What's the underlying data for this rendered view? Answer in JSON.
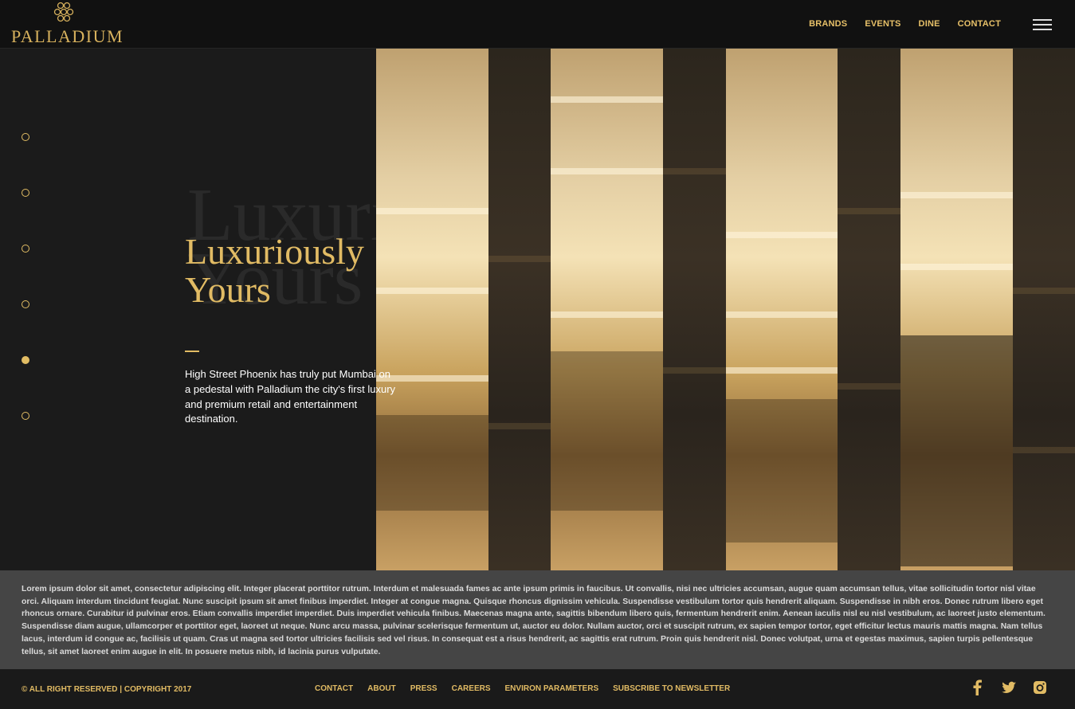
{
  "header": {
    "logo_text": "PALLADIUM",
    "nav": [
      "BRANDS",
      "EVENTS",
      "DINE",
      "CONTACT"
    ]
  },
  "hero": {
    "headline": "Luxuriously\nYours",
    "ghost_text": "Luxuriously\nYours",
    "description": "High Street Phoenix has truly put Mumbai on a pedestal with Palladium the city's first luxury and premium retail and entertainment destination."
  },
  "slider": {
    "count": 6,
    "active_index": 4
  },
  "body_text": "Lorem ipsum dolor sit amet, consectetur adipiscing elit. Integer placerat porttitor rutrum. Interdum et malesuada fames ac ante ipsum primis in faucibus. Ut convallis, nisi nec ultricies accumsan, augue quam accumsan tellus, vitae sollicitudin tortor nisl vitae orci. Aliquam interdum tincidunt feugiat. Nunc suscipit ipsum sit amet finibus imperdiet. Integer at congue magna. Quisque rhoncus dignissim vehicula. Suspendisse vestibulum tortor quis hendrerit aliquam. Suspendisse in nibh eros. Donec rutrum libero eget rhoncus ornare. Curabitur id pulvinar eros. Etiam convallis imperdiet imperdiet. Duis imperdiet vehicula finibus. Maecenas magna ante, sagittis bibendum libero quis, fermentum hendrerit enim. Aenean iaculis nisl eu nisl vestibulum, ac laoreet justo elementum. Suspendisse diam augue, ullamcorper et porttitor eget, laoreet ut neque. Nunc arcu massa, pulvinar scelerisque fermentum ut, auctor eu dolor. Nullam auctor, orci et suscipit rutrum, ex sapien tempor tortor, eget efficitur lectus mauris mattis magna. Nam tellus lacus, interdum id congue ac, facilisis ut quam. Cras ut magna sed tortor ultricies facilisis sed vel risus. In consequat est a risus hendrerit, ac sagittis erat rutrum. Proin quis hendrerit nisl. Donec volutpat, urna et egestas maximus, sapien turpis pellentesque tellus, sit amet laoreet enim augue in elit. In posuere metus nibh, id lacinia purus vulputate.",
  "footer": {
    "copyright": "© ALL RIGHT RESERVED  |  COPYRIGHT 2017",
    "links": [
      "CONTACT",
      "ABOUT",
      "PRESS",
      "CAREERS",
      "ENVIRON PARAMETERS",
      "SUBSCRIBE TO NEWSLETTER"
    ],
    "social": [
      "facebook-icon",
      "twitter-icon",
      "instagram-icon"
    ]
  },
  "colors": {
    "accent": "#e1bb64",
    "background": "#1b1b1b",
    "header": "#111111",
    "lorem_band": "#454545"
  }
}
